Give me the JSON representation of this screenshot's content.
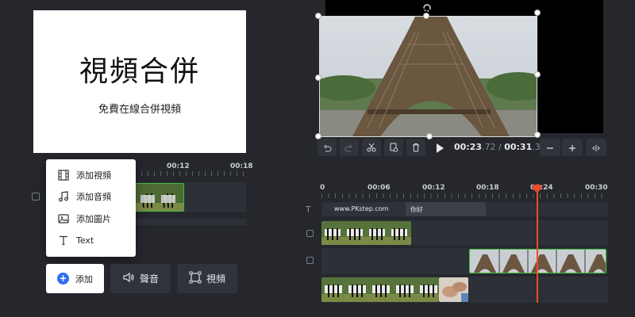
{
  "slide": {
    "title": "視頻合併",
    "subtitle": "免費在線合併視頻"
  },
  "left_ruler": {
    "labels": [
      "00:12",
      "00:18"
    ]
  },
  "add_menu": {
    "items": [
      {
        "label": "添加視頻",
        "icon": "film-icon"
      },
      {
        "label": "添加音頻",
        "icon": "music-note-icon"
      },
      {
        "label": "添加圖片",
        "icon": "image-icon"
      },
      {
        "label": "Text",
        "icon": "text-icon"
      }
    ]
  },
  "toolbar": {
    "add_label": "添加",
    "sound_label": "聲音",
    "video_label": "視頻"
  },
  "playback": {
    "current": "00:23",
    "current_frac": ".72",
    "separator": " / ",
    "total": "00:31",
    "total_frac": ".38"
  },
  "timeline": {
    "ruler_labels": [
      "0",
      "00:06",
      "00:12",
      "00:18",
      "00:24",
      "00:30"
    ],
    "text_track_label": "T",
    "text_clips": [
      "www.PKstep.com",
      "你好"
    ]
  },
  "colors": {
    "accent": "#2f6cf6",
    "playhead": "#ef4b2a",
    "clip_border": "#3fbf3f",
    "background": "#25272d"
  }
}
